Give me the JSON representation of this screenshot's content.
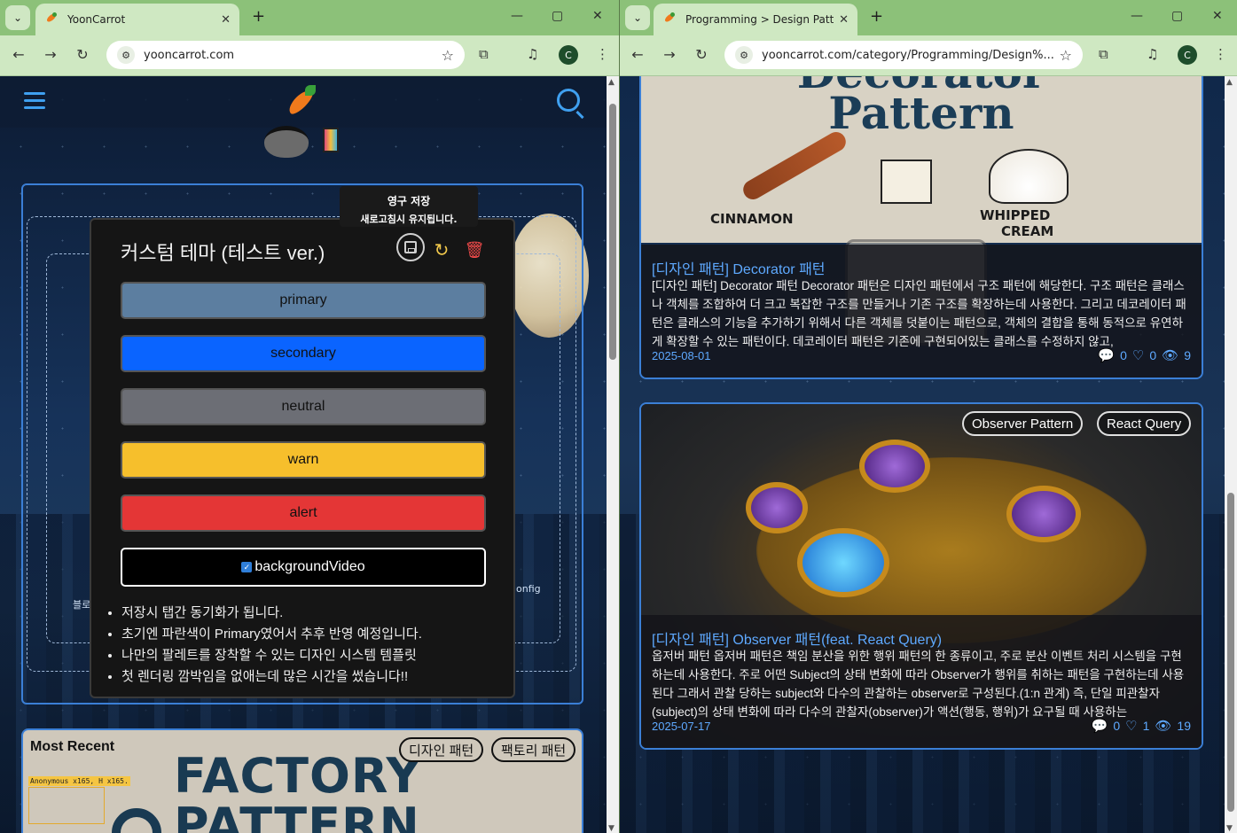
{
  "left_window": {
    "tab": {
      "title": "YoonCarrot",
      "close": "✕"
    },
    "newtab": "+",
    "controls": {
      "minimize": "—",
      "maximize": "▢",
      "close": "✕"
    },
    "url": "yooncarrot.com",
    "profile_initial": "C",
    "theme_panel": {
      "title": "커스텀 테마 (테스트 ver.)",
      "tooltip_title": "영구 저장",
      "tooltip_desc": "새로고침시 유지됩니다.",
      "swatches": [
        {
          "label": "primary",
          "color": "#5c7ea0"
        },
        {
          "label": "secondary",
          "color": "#0a64ff"
        },
        {
          "label": "neutral",
          "color": "#6c6e75"
        },
        {
          "label": "warn",
          "color": "#f6bf2c"
        },
        {
          "label": "alert",
          "color": "#e43636"
        }
      ],
      "background_video_label": "backgroundVideo",
      "background_video_checked": true,
      "notes": [
        "저장시 탭간 동기화가 됩니다.",
        "초기엔 파란색이 Primary였어서 추후 반영 예정입니다.",
        "나만의 팔레트를 장착할 수 있는 디자인 시스템 템플릿",
        "첫 렌더링 깜박임을 없애는데 많은 시간을 썼습니다!!"
      ]
    },
    "background_labels": {
      "left": "블로",
      "right": "onfig"
    },
    "recent_card": {
      "label": "Most Recent",
      "tags": [
        "디자인 패턴",
        "팩토리 패턴"
      ],
      "image_title_1": "FACTORY",
      "image_title_2": "PATTERN",
      "debug_label": "Anonymous x165, H x165."
    },
    "scroll": {
      "thumb_fraction_start": 0.02,
      "thumb_fraction_size": 0.35
    }
  },
  "right_window": {
    "tab": {
      "title": "Programming > Design Patter",
      "close": "✕"
    },
    "newtab": "+",
    "controls": {
      "minimize": "—",
      "maximize": "▢",
      "close": "✕"
    },
    "url": "yooncarrot.com/category/Programming/Design%...",
    "profile_initial": "C",
    "posts": [
      {
        "image_words": {
          "top": "Decorator",
          "title": "Pattern",
          "left": "CINNAMON",
          "right_1": "WHIPPED",
          "right_2": "CREAM"
        },
        "title": "[디자인 패턴] Decorator 패턴",
        "excerpt": "[디자인 패턴] Decorator 패턴 Decorator 패턴은 디자인 패턴에서 구조 패턴에 해당한다. 구조 패턴은 클래스나 객체를 조합하여 더 크고 복잡한 구조를 만들거나 기존 구조를 확장하는데 사용한다. 그리고 데코레이터 패턴은 클래스의 기능을 추가하기 위해서 다른 객체를 덧붙이는 패턴으로, 객체의 결합을 통해 동적으로 유연하게 확장할 수 있는 패턴이다. 데코레이터 패턴은 기존에 구현되어있는 클래스를 수정하지 않고,",
        "date": "2025-08-01",
        "comments": "0",
        "likes": "0",
        "views": "9"
      },
      {
        "tags": [
          "Observer Pattern",
          "React Query"
        ],
        "title": "[디자인 패턴] Observer 패턴(feat. React Query)",
        "excerpt": "옵저버 패턴 옵저버 패턴은 책임 분산을 위한 행위 패턴의 한 종류이고, 주로 분산 이벤트 처리 시스템을 구현하는데 사용한다. 주로 어떤 Subject의 상태 변화에 따라 Observer가 행위를 취하는 패턴을 구현하는데 사용된다 그래서 관찰 당하는 subject와 다수의 관찰하는 observer로 구성된다.(1:n 관계) 즉, 단일 피관찰자(subject)의 상태 변화에 따라 다수의 관찰자(observer)가 액션(행동, 행위)가 요구될 때 사용하는",
        "date": "2025-07-17",
        "comments": "0",
        "likes": "1",
        "views": "19"
      }
    ]
  },
  "colors": {
    "accent": "#3b7fd6",
    "link": "#5ea9ff",
    "chrome": "#8cc179",
    "toolbar": "#cfe8c2"
  }
}
